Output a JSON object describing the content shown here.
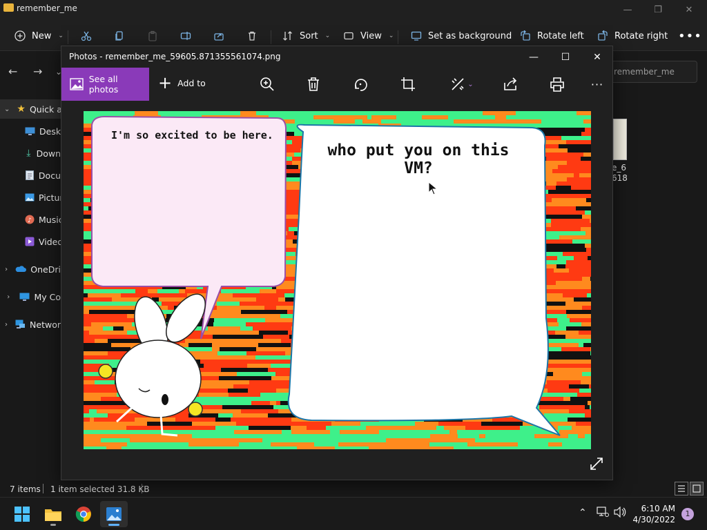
{
  "explorer": {
    "title": "remember_me",
    "toolbar": {
      "new_label": "New",
      "sort_label": "Sort",
      "view_label": "View",
      "set_background_label": "Set as background",
      "rotate_left_label": "Rotate left",
      "rotate_right_label": "Rotate right"
    },
    "search_placeholder": "remember_me",
    "sidebar": {
      "items": [
        {
          "label": "Quick a"
        },
        {
          "label": "Deskt"
        },
        {
          "label": "Down"
        },
        {
          "label": "Docu"
        },
        {
          "label": "Pictur"
        },
        {
          "label": "Music"
        },
        {
          "label": "Video"
        },
        {
          "label": "OneDri"
        },
        {
          "label": "My Co"
        },
        {
          "label": "Networ"
        }
      ]
    },
    "file": {
      "name_line1": "e_6",
      "name_line2": "618"
    },
    "status": {
      "items_count": "7 items",
      "selection": "1 item selected  31.8 KB"
    }
  },
  "photos": {
    "title": "Photos - remember_me_59605.871355561074.png",
    "see_all_label": "See all photos",
    "add_to_label": "Add to",
    "meme": {
      "left_bubble_text": "I'm so excited to be here.",
      "right_bubble_line1": "who put you on this",
      "right_bubble_line2": "VM?"
    }
  },
  "taskbar": {
    "time": "6:10 AM",
    "date": "4/30/2022",
    "notification_count": "1"
  },
  "colors": {
    "accent_purple": "#8a3ab9",
    "folder_yellow": "#e9b43c",
    "meme_green": "#3ef08a",
    "meme_red": "#ff3a12",
    "meme_orange": "#ff8a1e"
  }
}
